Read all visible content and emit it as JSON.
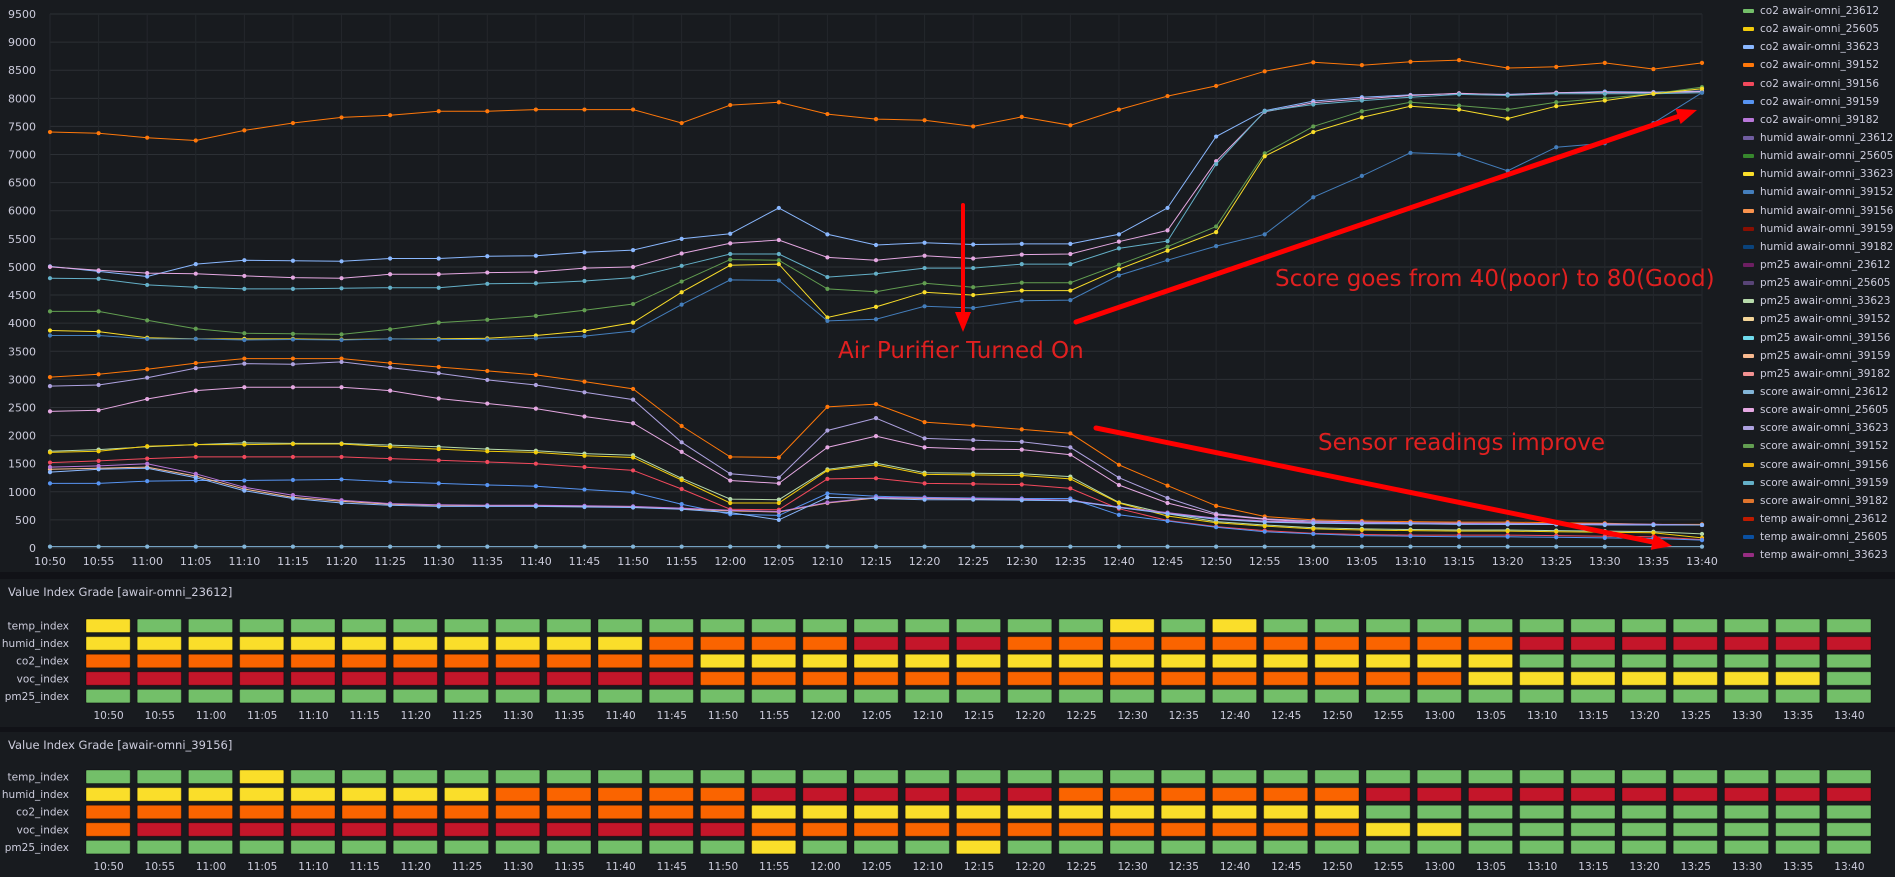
{
  "colors": {
    "poor": "#c4162a",
    "bad": "#fa6400",
    "fair": "#fade2a",
    "good": "#73bf69",
    "arrow": "#f00",
    "annotation": "#e02020"
  },
  "annotations": {
    "purifier": "Air Purifier Turned On",
    "score": "Score goes from 40(poor) to 80(Good)",
    "sensor": "Sensor readings improve"
  },
  "legend": [
    {
      "label": "co2 awair-omni_23612",
      "color": "#73bf69"
    },
    {
      "label": "co2 awair-omni_25605",
      "color": "#f2cc0c"
    },
    {
      "label": "co2 awair-omni_33623",
      "color": "#8ab8ff"
    },
    {
      "label": "co2 awair-omni_39152",
      "color": "#ff780a"
    },
    {
      "label": "co2 awair-omni_39156",
      "color": "#f2495c"
    },
    {
      "label": "co2 awair-omni_39159",
      "color": "#5794f2"
    },
    {
      "label": "co2 awair-omni_39182",
      "color": "#b877d9"
    },
    {
      "label": "humid awair-omni_23612",
      "color": "#705da0"
    },
    {
      "label": "humid awair-omni_25605",
      "color": "#37872d"
    },
    {
      "label": "humid awair-omni_33623",
      "color": "#fade2a"
    },
    {
      "label": "humid awair-omni_39152",
      "color": "#447ebc"
    },
    {
      "label": "humid awair-omni_39156",
      "color": "#f9934e"
    },
    {
      "label": "humid awair-omni_39159",
      "color": "#890f02"
    },
    {
      "label": "humid awair-omni_39182",
      "color": "#0a437c"
    },
    {
      "label": "pm25 awair-omni_23612",
      "color": "#6d1f62"
    },
    {
      "label": "pm25 awair-omni_25605",
      "color": "#584477"
    },
    {
      "label": "pm25 awair-omni_33623",
      "color": "#b7dbab"
    },
    {
      "label": "pm25 awair-omni_39152",
      "color": "#f4d598"
    },
    {
      "label": "pm25 awair-omni_39156",
      "color": "#70dbed"
    },
    {
      "label": "pm25 awair-omni_39159",
      "color": "#f9ba8f"
    },
    {
      "label": "pm25 awair-omni_39182",
      "color": "#f29191"
    },
    {
      "label": "score awair-omni_23612",
      "color": "#82b5d8"
    },
    {
      "label": "score awair-omni_25605",
      "color": "#e5a8e2"
    },
    {
      "label": "score awair-omni_33623",
      "color": "#aea2e0"
    },
    {
      "label": "score awair-omni_39152",
      "color": "#629e51"
    },
    {
      "label": "score awair-omni_39156",
      "color": "#e5ac0e"
    },
    {
      "label": "score awair-omni_39159",
      "color": "#64b0c8"
    },
    {
      "label": "score awair-omni_39182",
      "color": "#e0752d"
    },
    {
      "label": "temp awair-omni_23612",
      "color": "#bf1b00"
    },
    {
      "label": "temp awair-omni_25605",
      "color": "#0a50a1"
    },
    {
      "label": "temp awair-omni_33623",
      "color": "#962d82"
    }
  ],
  "chart_data": {
    "type": "line",
    "ylim": [
      0,
      9500
    ],
    "yticks": [
      0,
      500,
      1000,
      1500,
      2000,
      2500,
      3000,
      3500,
      4000,
      4500,
      5000,
      5500,
      6000,
      6500,
      7000,
      7500,
      8000,
      8500,
      9000,
      9500
    ],
    "x": [
      "10:50",
      "10:55",
      "11:00",
      "11:05",
      "11:10",
      "11:15",
      "11:20",
      "11:25",
      "11:30",
      "11:35",
      "11:40",
      "11:45",
      "11:50",
      "11:55",
      "12:00",
      "12:05",
      "12:10",
      "12:15",
      "12:20",
      "12:25",
      "12:30",
      "12:35",
      "12:40",
      "12:45",
      "12:50",
      "12:55",
      "13:00",
      "13:05",
      "13:10",
      "13:15",
      "13:20",
      "13:25",
      "13:30",
      "13:35",
      "13:40"
    ],
    "series": [
      {
        "color": "#ff780a",
        "values": [
          7400,
          7380,
          7300,
          7250,
          7430,
          7560,
          7660,
          7700,
          7770,
          7770,
          7800,
          7800,
          7800,
          7560,
          7880,
          7930,
          7720,
          7630,
          7610,
          7500,
          7670,
          7520,
          7800,
          8040,
          8220,
          8480,
          8640,
          8590,
          8650,
          8680,
          8540,
          8560,
          8630,
          8520,
          8630
        ]
      },
      {
        "color": "#8ab8ff",
        "values": [
          5010,
          4920,
          4830,
          5050,
          5120,
          5110,
          5100,
          5150,
          5150,
          5190,
          5200,
          5260,
          5300,
          5500,
          5590,
          6050,
          5580,
          5390,
          5430,
          5400,
          5410,
          5410,
          5580,
          6050,
          7320,
          7780,
          7950,
          8020,
          8060,
          8080,
          8070,
          8100,
          8120,
          8110,
          8130
        ]
      },
      {
        "color": "#e5a8e2",
        "values": [
          5000,
          4940,
          4890,
          4880,
          4840,
          4810,
          4800,
          4870,
          4870,
          4900,
          4910,
          4980,
          5000,
          5240,
          5420,
          5480,
          5170,
          5120,
          5200,
          5150,
          5220,
          5230,
          5450,
          5650,
          6880,
          7760,
          7920,
          7990,
          8050,
          8090,
          8060,
          8100,
          8100,
          8100,
          8120
        ]
      },
      {
        "color": "#64b0c8",
        "values": [
          4800,
          4790,
          4680,
          4640,
          4610,
          4610,
          4620,
          4630,
          4630,
          4700,
          4710,
          4750,
          4810,
          5020,
          5230,
          5230,
          4820,
          4880,
          4980,
          4980,
          5050,
          5050,
          5330,
          5460,
          6830,
          7770,
          7890,
          7960,
          8020,
          8070,
          8050,
          8080,
          8080,
          8080,
          8100
        ]
      },
      {
        "color": "#629e51",
        "values": [
          4210,
          4210,
          4050,
          3900,
          3820,
          3810,
          3800,
          3890,
          4010,
          4060,
          4130,
          4230,
          4340,
          4740,
          5130,
          5120,
          4610,
          4560,
          4710,
          4640,
          4720,
          4720,
          5040,
          5360,
          5720,
          7020,
          7500,
          7770,
          7930,
          7870,
          7800,
          7930,
          8000,
          8080,
          8200
        ]
      },
      {
        "color": "#fade2a",
        "values": [
          3870,
          3850,
          3740,
          3720,
          3720,
          3720,
          3710,
          3720,
          3720,
          3730,
          3780,
          3860,
          4010,
          4550,
          5030,
          5050,
          4100,
          4290,
          4550,
          4500,
          4580,
          4580,
          4960,
          5290,
          5620,
          6970,
          7400,
          7660,
          7860,
          7800,
          7640,
          7860,
          7960,
          8080,
          8170
        ]
      },
      {
        "color": "#447ebc",
        "values": [
          3780,
          3780,
          3720,
          3720,
          3700,
          3710,
          3700,
          3720,
          3710,
          3710,
          3730,
          3770,
          3860,
          4330,
          4770,
          4760,
          4040,
          4070,
          4300,
          4270,
          4400,
          4410,
          4850,
          5120,
          5370,
          5580,
          6240,
          6620,
          7030,
          7000,
          6710,
          7130,
          7200,
          7560,
          8100
        ]
      },
      {
        "color": "#ff780a",
        "values": [
          3040,
          3090,
          3180,
          3290,
          3370,
          3370,
          3370,
          3290,
          3220,
          3150,
          3080,
          2960,
          2830,
          2170,
          1620,
          1610,
          2510,
          2560,
          2240,
          2180,
          2110,
          2040,
          1480,
          1110,
          750,
          560,
          500,
          480,
          470,
          460,
          460,
          450,
          440,
          420,
          420
        ]
      },
      {
        "color": "#aea2e0",
        "values": [
          2880,
          2900,
          3030,
          3200,
          3280,
          3270,
          3310,
          3210,
          3110,
          2990,
          2900,
          2770,
          2640,
          1880,
          1320,
          1250,
          2090,
          2310,
          1950,
          1920,
          1890,
          1790,
          1250,
          890,
          610,
          520,
          480,
          460,
          450,
          440,
          440,
          430,
          430,
          420,
          410
        ]
      },
      {
        "color": "#e5a8e2",
        "values": [
          2430,
          2450,
          2650,
          2800,
          2860,
          2860,
          2860,
          2800,
          2660,
          2570,
          2480,
          2340,
          2220,
          1710,
          1200,
          1150,
          1790,
          1990,
          1790,
          1760,
          1750,
          1660,
          1120,
          800,
          590,
          510,
          460,
          450,
          440,
          430,
          430,
          420,
          420,
          410,
          410
        ]
      },
      {
        "color": "#b7dbab",
        "values": [
          1720,
          1750,
          1800,
          1840,
          1870,
          1860,
          1860,
          1830,
          1800,
          1760,
          1730,
          1680,
          1650,
          1240,
          870,
          860,
          1400,
          1510,
          1340,
          1330,
          1320,
          1270,
          810,
          610,
          470,
          410,
          360,
          340,
          330,
          320,
          320,
          310,
          300,
          290,
          250
        ]
      },
      {
        "color": "#f2cc0c",
        "values": [
          1700,
          1720,
          1810,
          1840,
          1840,
          1850,
          1850,
          1800,
          1760,
          1720,
          1700,
          1640,
          1610,
          1210,
          800,
          800,
          1380,
          1480,
          1310,
          1300,
          1290,
          1230,
          800,
          570,
          450,
          390,
          340,
          320,
          310,
          300,
          300,
          290,
          280,
          270,
          180
        ]
      },
      {
        "color": "#f2495c",
        "values": [
          1520,
          1550,
          1590,
          1620,
          1620,
          1620,
          1620,
          1590,
          1560,
          1530,
          1500,
          1440,
          1380,
          1050,
          690,
          680,
          1230,
          1240,
          1150,
          1140,
          1130,
          1060,
          700,
          490,
          380,
          310,
          260,
          240,
          230,
          230,
          230,
          220,
          210,
          200,
          150
        ]
      },
      {
        "color": "#5794f2",
        "values": [
          1150,
          1150,
          1190,
          1200,
          1200,
          1210,
          1220,
          1180,
          1150,
          1120,
          1100,
          1040,
          990,
          780,
          600,
          580,
          970,
          920,
          900,
          890,
          880,
          880,
          590,
          480,
          370,
          290,
          250,
          220,
          210,
          200,
          200,
          190,
          180,
          170,
          140
        ]
      },
      {
        "color": "#f9ba8f",
        "values": [
          1400,
          1420,
          1440,
          1280,
          1050,
          900,
          830,
          780,
          760,
          750,
          750,
          740,
          730,
          700,
          660,
          640,
          800,
          890,
          880,
          870,
          860,
          850,
          720,
          620,
          520,
          470,
          450,
          440,
          430,
          430,
          420,
          420,
          420,
          410,
          410
        ]
      },
      {
        "color": "#b877d9",
        "values": [
          1440,
          1460,
          1500,
          1320,
          1080,
          940,
          850,
          790,
          770,
          760,
          760,
          750,
          740,
          710,
          670,
          650,
          810,
          900,
          890,
          880,
          870,
          850,
          730,
          630,
          530,
          480,
          460,
          450,
          440,
          440,
          430,
          430,
          420,
          420,
          410
        ]
      },
      {
        "color": "#8ab8ff",
        "values": [
          1350,
          1400,
          1420,
          1250,
          1020,
          880,
          800,
          760,
          740,
          740,
          740,
          730,
          720,
          690,
          630,
          500,
          900,
          880,
          860,
          860,
          850,
          840,
          720,
          610,
          510,
          460,
          440,
          430,
          430,
          420,
          420,
          420,
          410,
          410,
          410
        ]
      },
      {
        "color": "#82b5d8",
        "values": [
          25,
          25,
          25,
          25,
          25,
          25,
          25,
          25,
          25,
          25,
          25,
          25,
          25,
          25,
          25,
          25,
          25,
          25,
          25,
          25,
          25,
          25,
          25,
          25,
          25,
          25,
          25,
          25,
          25,
          25,
          25,
          25,
          25,
          25,
          25
        ]
      }
    ]
  },
  "grids": [
    {
      "title": "Value Index Grade [awair-omni_23612]",
      "row_labels": [
        "temp_index",
        "humid_index",
        "co2_index",
        "voc_index",
        "pm25_index"
      ],
      "x": [
        "10:50",
        "10:55",
        "11:00",
        "11:05",
        "11:10",
        "11:15",
        "11:20",
        "11:25",
        "11:30",
        "11:35",
        "11:40",
        "11:45",
        "11:50",
        "11:55",
        "12:00",
        "12:05",
        "12:10",
        "12:15",
        "12:20",
        "12:25",
        "12:30",
        "12:35",
        "12:40",
        "12:45",
        "12:50",
        "12:55",
        "13:00",
        "13:05",
        "13:10",
        "13:15",
        "13:20",
        "13:25",
        "13:30",
        "13:35",
        "13:40"
      ],
      "cells": [
        "YGGGGGGGGGGGGGGGGGGGYGYGGGGGGGGGGGG",
        "YYYYYYYYYYYOOOORRROOOOOOOOOORRRRRRR",
        "OOOOOOOOOOOOYYYYYYYYYYYYYYYYGGGGGGG",
        "RRRRRRRRRRRROOOOOOOOOOOOOOOYYYYYYYGG",
        "GGGGGGGGGGGGGGGGGGGGGGGGGGGGGGGGGGG"
      ]
    },
    {
      "title": "Value Index Grade [awair-omni_39156]",
      "row_labels": [
        "temp_index",
        "humid_index",
        "co2_index",
        "voc_index",
        "pm25_index"
      ],
      "x": [
        "10:50",
        "10:55",
        "11:00",
        "11:05",
        "11:10",
        "11:15",
        "11:20",
        "11:25",
        "11:30",
        "11:35",
        "11:40",
        "11:45",
        "11:50",
        "11:55",
        "12:00",
        "12:05",
        "12:10",
        "12:15",
        "12:20",
        "12:25",
        "12:30",
        "12:35",
        "12:40",
        "12:45",
        "12:50",
        "12:55",
        "13:00",
        "13:05",
        "13:10",
        "13:15",
        "13:20",
        "13:25",
        "13:30",
        "13:35",
        "13:40"
      ],
      "cells": [
        "GGGYGGGGGGGGGGGGGGGGGGGGGGGGGGGGGGG",
        "YYYYYYYYOOOOORRRRRROOOOOORRRRRRRRRR",
        "OOOOOOOOOOOOOYYYYYYYYYYYYGGGGGGGGGG",
        "ORRRRRRRRRRRROOOOOOOOOOOOYYGGGGGGGG",
        "GGGGGGGGGGGGGYGGGYGGGGGGGGGGGGGGGGG"
      ]
    }
  ]
}
